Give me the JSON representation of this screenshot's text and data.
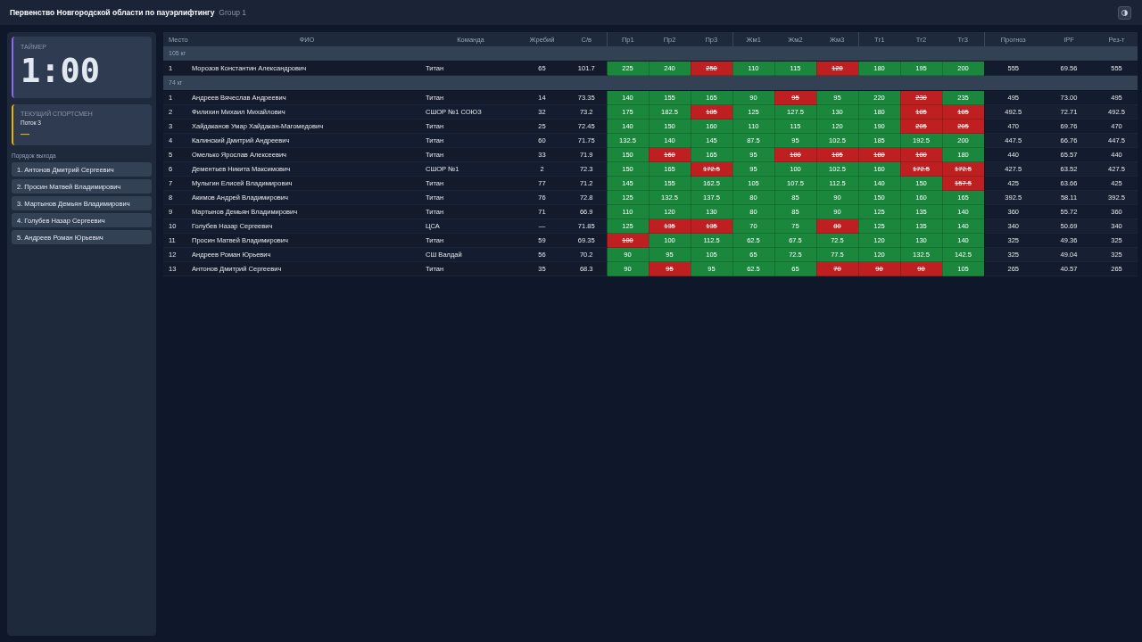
{
  "header": {
    "title": "Первенство Новгородской области по пауэрлифтингу",
    "group": "Group 1"
  },
  "sidebar": {
    "timer": {
      "label": "ТАЙМЕР",
      "value": "1:00"
    },
    "current_athlete": {
      "label": "ТЕКУЩИЙ СПОРТСМЕН",
      "flow": "Поток 3",
      "name": "—"
    },
    "order_title": "Порядок выхода",
    "order": [
      "1. Антонов Дмитрий Сергеевич",
      "2. Просин Матвей Владимирович",
      "3. Мартынов Демьян Владимирович",
      "4. Голубев Назар Сергеевич",
      "5. Андреев Роман Юрьевич"
    ]
  },
  "table": {
    "columns": [
      "Место",
      "ФИО",
      "Команда",
      "Жребий",
      "С/в",
      "Пр1",
      "Пр2",
      "Пр3",
      "Жм1",
      "Жм2",
      "Жм3",
      "Тг1",
      "Тг2",
      "Тг3",
      "Прогноз",
      "IPF",
      "Рез-т"
    ],
    "groups": [
      {
        "title": "105 кг",
        "rows": [
          {
            "place": "1",
            "name": "Морозов Константин Александрович",
            "team": "Титан",
            "lot": "65",
            "bodyweight": "101.7",
            "attempts": [
              {
                "value": "225",
                "good": true
              },
              {
                "value": "240",
                "good": true
              },
              {
                "value": "250",
                "good": false
              },
              {
                "value": "110",
                "good": true
              },
              {
                "value": "115",
                "good": true
              },
              {
                "value": "120",
                "good": false
              },
              {
                "value": "180",
                "good": true
              },
              {
                "value": "195",
                "good": true
              },
              {
                "value": "200",
                "good": true
              }
            ],
            "forecast": "555",
            "ipf": "69.56",
            "total": "555"
          }
        ]
      },
      {
        "title": "74 кг",
        "rows": [
          {
            "place": "1",
            "name": "Андреев Вячеслав Андреевич",
            "team": "Титан",
            "lot": "14",
            "bodyweight": "73.35",
            "attempts": [
              {
                "value": "140",
                "good": true
              },
              {
                "value": "155",
                "good": true
              },
              {
                "value": "165",
                "good": true
              },
              {
                "value": "90",
                "good": true
              },
              {
                "value": "95",
                "good": false
              },
              {
                "value": "95",
                "good": true
              },
              {
                "value": "220",
                "good": true
              },
              {
                "value": "230",
                "good": false
              },
              {
                "value": "235",
                "good": true
              }
            ],
            "forecast": "495",
            "ipf": "73.00",
            "total": "495"
          },
          {
            "place": "2",
            "name": "Филихин Михаил Михайлович",
            "team": "СШОР №1 СОЮЗ",
            "lot": "32",
            "bodyweight": "73.2",
            "attempts": [
              {
                "value": "175",
                "good": true
              },
              {
                "value": "182.5",
                "good": true
              },
              {
                "value": "185",
                "good": false
              },
              {
                "value": "125",
                "good": true
              },
              {
                "value": "127.5",
                "good": true
              },
              {
                "value": "130",
                "good": true
              },
              {
                "value": "180",
                "good": true
              },
              {
                "value": "185",
                "good": false
              },
              {
                "value": "185",
                "good": false
              }
            ],
            "forecast": "492.5",
            "ipf": "72.71",
            "total": "492.5"
          },
          {
            "place": "3",
            "name": "Хайдаканов Умар Хайдакан-Магомедович",
            "team": "Титан",
            "lot": "25",
            "bodyweight": "72.45",
            "attempts": [
              {
                "value": "140",
                "good": true
              },
              {
                "value": "150",
                "good": true
              },
              {
                "value": "160",
                "good": true
              },
              {
                "value": "110",
                "good": true
              },
              {
                "value": "115",
                "good": true
              },
              {
                "value": "120",
                "good": true
              },
              {
                "value": "190",
                "good": true
              },
              {
                "value": "205",
                "good": false
              },
              {
                "value": "205",
                "good": false
              }
            ],
            "forecast": "470",
            "ipf": "69.76",
            "total": "470"
          },
          {
            "place": "4",
            "name": "Калинский Дмитрий Андреевич",
            "team": "Титан",
            "lot": "60",
            "bodyweight": "71.75",
            "attempts": [
              {
                "value": "132.5",
                "good": true
              },
              {
                "value": "140",
                "good": true
              },
              {
                "value": "145",
                "good": true
              },
              {
                "value": "87.5",
                "good": true
              },
              {
                "value": "95",
                "good": true
              },
              {
                "value": "102.5",
                "good": true
              },
              {
                "value": "185",
                "good": true
              },
              {
                "value": "192.5",
                "good": true
              },
              {
                "value": "200",
                "good": true
              }
            ],
            "forecast": "447.5",
            "ipf": "66.76",
            "total": "447.5"
          },
          {
            "place": "5",
            "name": "Омелько Ярослав Алексеевич",
            "team": "Титан",
            "lot": "33",
            "bodyweight": "71.9",
            "attempts": [
              {
                "value": "150",
                "good": true
              },
              {
                "value": "160",
                "good": false
              },
              {
                "value": "165",
                "good": true
              },
              {
                "value": "95",
                "good": true
              },
              {
                "value": "100",
                "good": false
              },
              {
                "value": "105",
                "good": false
              },
              {
                "value": "180",
                "good": false
              },
              {
                "value": "180",
                "good": false
              },
              {
                "value": "180",
                "good": true
              }
            ],
            "forecast": "440",
            "ipf": "65.57",
            "total": "440"
          },
          {
            "place": "6",
            "name": "Дементьев Никита Максимович",
            "team": "СШОР №1",
            "lot": "2",
            "bodyweight": "72.3",
            "attempts": [
              {
                "value": "150",
                "good": true
              },
              {
                "value": "165",
                "good": true
              },
              {
                "value": "172.5",
                "good": false
              },
              {
                "value": "95",
                "good": true
              },
              {
                "value": "100",
                "good": true
              },
              {
                "value": "102.5",
                "good": true
              },
              {
                "value": "160",
                "good": true
              },
              {
                "value": "172.5",
                "good": false
              },
              {
                "value": "172.5",
                "good": false
              }
            ],
            "forecast": "427.5",
            "ipf": "63.52",
            "total": "427.5"
          },
          {
            "place": "7",
            "name": "Мулыгин Елисей Владимирович",
            "team": "Титан",
            "lot": "77",
            "bodyweight": "71.2",
            "attempts": [
              {
                "value": "145",
                "good": true
              },
              {
                "value": "155",
                "good": true
              },
              {
                "value": "162.5",
                "good": true
              },
              {
                "value": "105",
                "good": true
              },
              {
                "value": "107.5",
                "good": true
              },
              {
                "value": "112.5",
                "good": true
              },
              {
                "value": "140",
                "good": true
              },
              {
                "value": "150",
                "good": true
              },
              {
                "value": "157.5",
                "good": false
              }
            ],
            "forecast": "425",
            "ipf": "63.66",
            "total": "425"
          },
          {
            "place": "8",
            "name": "Акимов Андрей Владимирович",
            "team": "Титан",
            "lot": "76",
            "bodyweight": "72.8",
            "attempts": [
              {
                "value": "125",
                "good": true
              },
              {
                "value": "132.5",
                "good": true
              },
              {
                "value": "137.5",
                "good": true
              },
              {
                "value": "80",
                "good": true
              },
              {
                "value": "85",
                "good": true
              },
              {
                "value": "90",
                "good": true
              },
              {
                "value": "150",
                "good": true
              },
              {
                "value": "160",
                "good": true
              },
              {
                "value": "165",
                "good": true
              }
            ],
            "forecast": "392.5",
            "ipf": "58.11",
            "total": "392.5"
          },
          {
            "place": "9",
            "name": "Мартынов Демьян Владимирович",
            "team": "Титан",
            "lot": "71",
            "bodyweight": "66.9",
            "attempts": [
              {
                "value": "110",
                "good": true
              },
              {
                "value": "120",
                "good": true
              },
              {
                "value": "130",
                "good": true
              },
              {
                "value": "80",
                "good": true
              },
              {
                "value": "85",
                "good": true
              },
              {
                "value": "90",
                "good": true
              },
              {
                "value": "125",
                "good": true
              },
              {
                "value": "135",
                "good": true
              },
              {
                "value": "140",
                "good": true
              }
            ],
            "forecast": "360",
            "ipf": "55.72",
            "total": "360"
          },
          {
            "place": "10",
            "name": "Голубев Назар Сергеевич",
            "team": "ЦСА",
            "lot": "—",
            "bodyweight": "71.85",
            "attempts": [
              {
                "value": "125",
                "good": true
              },
              {
                "value": "135",
                "good": false
              },
              {
                "value": "135",
                "good": false
              },
              {
                "value": "70",
                "good": true
              },
              {
                "value": "75",
                "good": true
              },
              {
                "value": "80",
                "good": false
              },
              {
                "value": "125",
                "good": true
              },
              {
                "value": "135",
                "good": true
              },
              {
                "value": "140",
                "good": true
              }
            ],
            "forecast": "340",
            "ipf": "50.69",
            "total": "340"
          },
          {
            "place": "11",
            "name": "Просин Матвей Владимирович",
            "team": "Титан",
            "lot": "59",
            "bodyweight": "69.35",
            "attempts": [
              {
                "value": "100",
                "good": false
              },
              {
                "value": "100",
                "good": true
              },
              {
                "value": "112.5",
                "good": true
              },
              {
                "value": "62.5",
                "good": true
              },
              {
                "value": "67.5",
                "good": true
              },
              {
                "value": "72.5",
                "good": true
              },
              {
                "value": "120",
                "good": true
              },
              {
                "value": "130",
                "good": true
              },
              {
                "value": "140",
                "good": true
              }
            ],
            "forecast": "325",
            "ipf": "49.36",
            "total": "325"
          },
          {
            "place": "12",
            "name": "Андреев Роман Юрьевич",
            "team": "СШ Валдай",
            "lot": "56",
            "bodyweight": "70.2",
            "attempts": [
              {
                "value": "90",
                "good": true
              },
              {
                "value": "95",
                "good": true
              },
              {
                "value": "105",
                "good": true
              },
              {
                "value": "65",
                "good": true
              },
              {
                "value": "72.5",
                "good": true
              },
              {
                "value": "77.5",
                "good": true
              },
              {
                "value": "120",
                "good": true
              },
              {
                "value": "132.5",
                "good": true
              },
              {
                "value": "142.5",
                "good": true
              }
            ],
            "forecast": "325",
            "ipf": "49.04",
            "total": "325"
          },
          {
            "place": "13",
            "name": "Антонов Дмитрий Сергеевич",
            "team": "Титан",
            "lot": "35",
            "bodyweight": "68.3",
            "attempts": [
              {
                "value": "90",
                "good": true
              },
              {
                "value": "95",
                "good": false
              },
              {
                "value": "95",
                "good": true
              },
              {
                "value": "62.5",
                "good": true
              },
              {
                "value": "65",
                "good": true
              },
              {
                "value": "70",
                "good": false
              },
              {
                "value": "90",
                "good": false
              },
              {
                "value": "90",
                "good": false
              },
              {
                "value": "105",
                "good": true
              }
            ],
            "forecast": "265",
            "ipf": "40.57",
            "total": "265"
          }
        ]
      }
    ]
  }
}
